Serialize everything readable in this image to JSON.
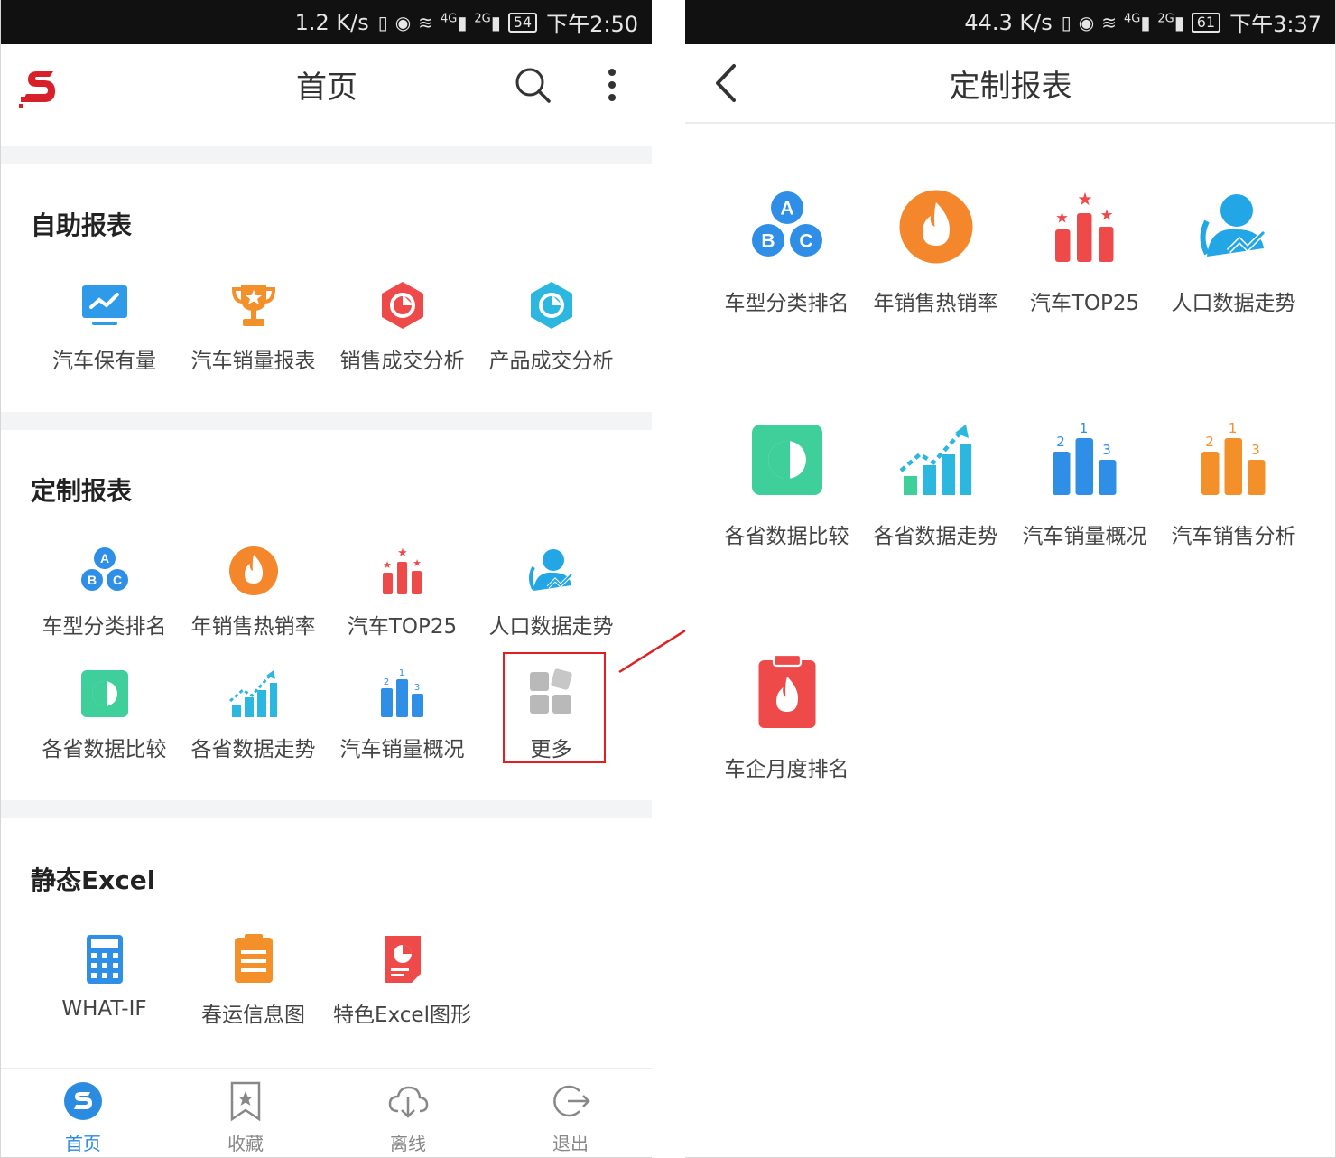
{
  "left_screen": {
    "status": {
      "speed": "1.2 K/s",
      "net1": "4G",
      "net2": "2G",
      "battery": "54",
      "time": "下午2:50"
    },
    "header": {
      "title": "首页"
    },
    "sections": {
      "self_service": {
        "title": "自助报表",
        "items": [
          {
            "label": "汽车保有量",
            "icon": "monitor-chart-icon",
            "color": "#2f9be8"
          },
          {
            "label": "汽车销量报表",
            "icon": "trophy-icon",
            "color": "#f4902a"
          },
          {
            "label": "销售成交分析",
            "icon": "hexagon-pie-icon",
            "color": "#ef4a4a"
          },
          {
            "label": "产品成交分析",
            "icon": "hexagon-pie-icon",
            "color": "#2bb7e0"
          }
        ]
      },
      "custom": {
        "title": "定制报表",
        "items": [
          {
            "label": "车型分类排名",
            "icon": "abc-circles-icon",
            "color": "#2f8fe6"
          },
          {
            "label": "年销售热销率",
            "icon": "fire-circle-icon",
            "color": "#f4872c"
          },
          {
            "label": "汽车TOP25",
            "icon": "star-bars-icon",
            "color": "#ef4a4a"
          },
          {
            "label": "人口数据走势",
            "icon": "person-trend-icon",
            "color": "#22a6e6"
          },
          {
            "label": "各省数据比较",
            "icon": "compare-square-icon",
            "color": "#3fcf9a"
          },
          {
            "label": "各省数据走势",
            "icon": "rising-bars-icon",
            "color": "#2bb7e0"
          },
          {
            "label": "汽车销量概况",
            "icon": "podium-bars-icon",
            "color": "#2f8fe6"
          },
          {
            "label": "更多",
            "icon": "more-grid-icon",
            "color": "#b9b9b9"
          }
        ]
      },
      "static_excel": {
        "title": "静态Excel",
        "items": [
          {
            "label": "WHAT-IF",
            "icon": "calculator-icon",
            "color": "#2f8fe6"
          },
          {
            "label": "春运信息图",
            "icon": "clipboard-list-icon",
            "color": "#f4902a"
          },
          {
            "label": "特色Excel图形",
            "icon": "doc-pie-icon",
            "color": "#ef4a4a"
          }
        ]
      }
    },
    "tabbar": [
      {
        "label": "首页",
        "icon": "home-logo-icon",
        "active": true
      },
      {
        "label": "收藏",
        "icon": "bookmark-star-icon",
        "active": false
      },
      {
        "label": "离线",
        "icon": "cloud-download-icon",
        "active": false
      },
      {
        "label": "退出",
        "icon": "logout-icon",
        "active": false
      }
    ]
  },
  "right_screen": {
    "status": {
      "speed": "44.3 K/s",
      "net1": "4G",
      "net2": "2G",
      "battery": "61",
      "time": "下午3:37"
    },
    "header": {
      "title": "定制报表"
    },
    "items": [
      {
        "label": "车型分类排名",
        "icon": "abc-circles-icon"
      },
      {
        "label": "年销售热销率",
        "icon": "fire-circle-icon"
      },
      {
        "label": "汽车TOP25",
        "icon": "star-bars-icon"
      },
      {
        "label": "人口数据走势",
        "icon": "person-trend-icon"
      },
      {
        "label": "各省数据比较",
        "icon": "compare-square-icon"
      },
      {
        "label": "各省数据走势",
        "icon": "rising-bars-icon"
      },
      {
        "label": "汽车销量概况",
        "icon": "podium-bars-icon"
      },
      {
        "label": "汽车销售分析",
        "icon": "podium-bars-orange-icon"
      },
      {
        "label": "车企月度排名",
        "icon": "clipboard-fire-icon"
      }
    ]
  },
  "annotation": {
    "highlight_color": "#e02020"
  }
}
